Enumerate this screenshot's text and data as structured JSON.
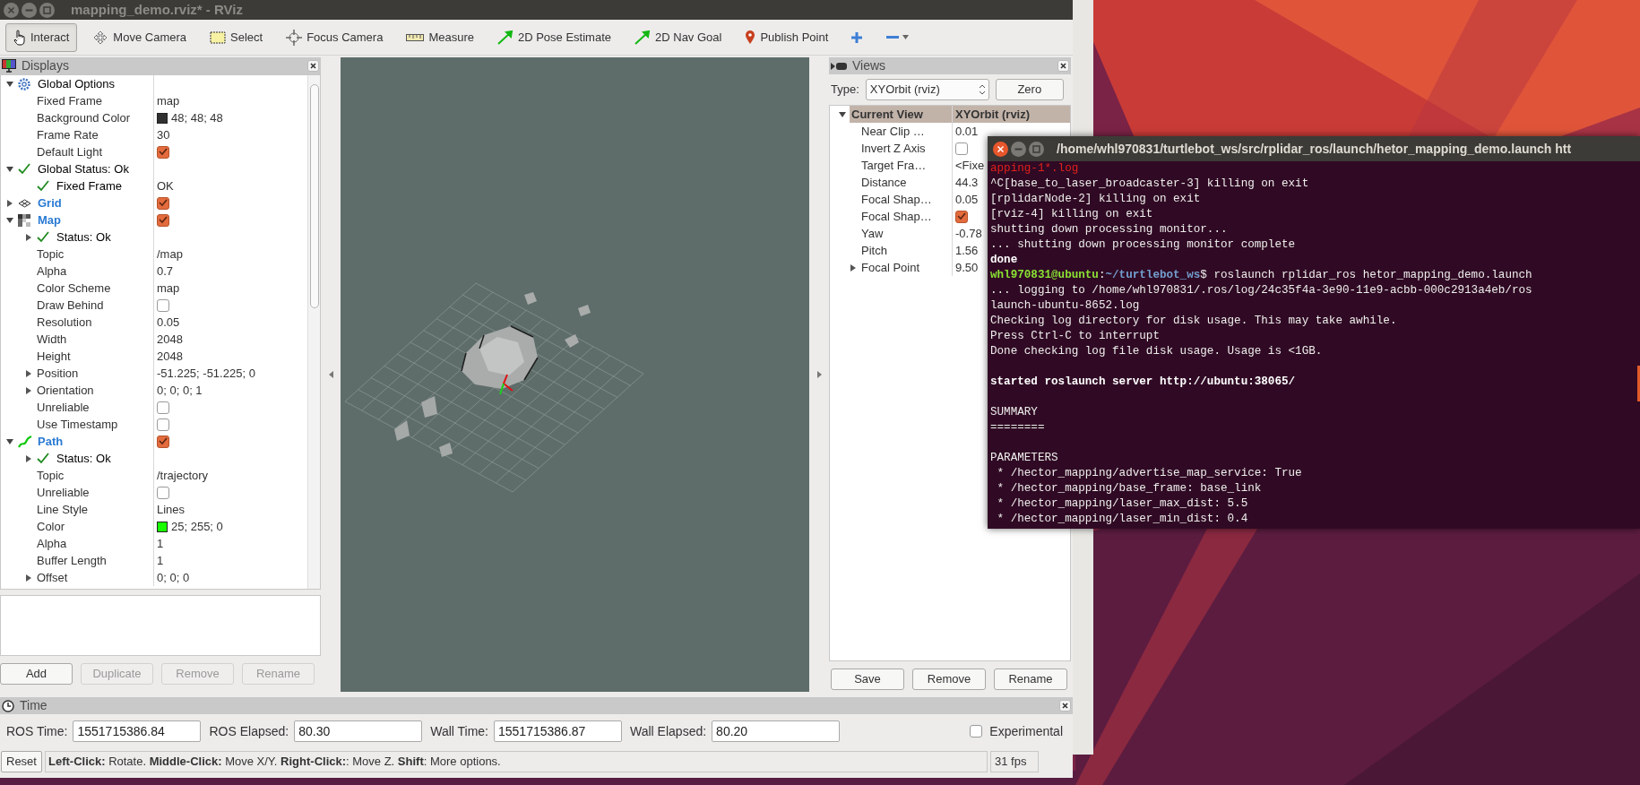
{
  "window": {
    "title": "mapping_demo.rviz* - RViz"
  },
  "toolbar": {
    "tools": [
      {
        "label": "Interact",
        "selected": true
      },
      {
        "label": "Move Camera",
        "selected": false
      },
      {
        "label": "Select",
        "selected": false
      },
      {
        "label": "Focus Camera",
        "selected": false
      },
      {
        "label": "Measure",
        "selected": false
      },
      {
        "label": "2D Pose Estimate",
        "selected": false
      },
      {
        "label": "2D Nav Goal",
        "selected": false
      },
      {
        "label": "Publish Point",
        "selected": false
      }
    ]
  },
  "displays": {
    "title": "Displays",
    "tree": [
      {
        "label": "Global Options",
        "kind": "options",
        "expanded": true,
        "children": [
          {
            "label": "Fixed Frame",
            "kind": "property",
            "value": "map"
          },
          {
            "label": "Background Color",
            "kind": "property",
            "value": "48; 48; 48",
            "color": "#303030"
          },
          {
            "label": "Frame Rate",
            "kind": "property",
            "value": "30"
          },
          {
            "label": "Default Light",
            "kind": "property",
            "checked": true
          }
        ]
      },
      {
        "label": "Global Status: Ok",
        "kind": "status",
        "expanded": true,
        "children": [
          {
            "label": "Fixed Frame",
            "kind": "status",
            "value": "OK"
          }
        ]
      },
      {
        "label": "Grid",
        "kind": "grid",
        "expanded": false,
        "checked": true
      },
      {
        "label": "Map",
        "kind": "map",
        "expanded": true,
        "checked": true,
        "children": [
          {
            "label": "Status: Ok",
            "kind": "status",
            "expanded": false
          },
          {
            "label": "Topic",
            "kind": "property",
            "value": "/map"
          },
          {
            "label": "Alpha",
            "kind": "property",
            "value": "0.7"
          },
          {
            "label": "Color Scheme",
            "kind": "property",
            "value": "map"
          },
          {
            "label": "Draw Behind",
            "kind": "property",
            "checked": false
          },
          {
            "label": "Resolution",
            "kind": "property",
            "value": "0.05"
          },
          {
            "label": "Width",
            "kind": "property",
            "value": "2048"
          },
          {
            "label": "Height",
            "kind": "property",
            "value": "2048"
          },
          {
            "label": "Position",
            "kind": "property",
            "expanded": false,
            "value": "-51.225; -51.225; 0"
          },
          {
            "label": "Orientation",
            "kind": "property",
            "expanded": false,
            "value": "0; 0; 0; 1"
          },
          {
            "label": "Unreliable",
            "kind": "property",
            "checked": false
          },
          {
            "label": "Use Timestamp",
            "kind": "property",
            "checked": false
          }
        ]
      },
      {
        "label": "Path",
        "kind": "path",
        "expanded": true,
        "checked": true,
        "children": [
          {
            "label": "Status: Ok",
            "kind": "status",
            "expanded": false
          },
          {
            "label": "Topic",
            "kind": "property",
            "value": "/trajectory"
          },
          {
            "label": "Unreliable",
            "kind": "property",
            "checked": false
          },
          {
            "label": "Line Style",
            "kind": "property",
            "value": "Lines"
          },
          {
            "label": "Color",
            "kind": "property",
            "value": "25; 255; 0",
            "color": "#19ff00"
          },
          {
            "label": "Alpha",
            "kind": "property",
            "value": "1"
          },
          {
            "label": "Buffer Length",
            "kind": "property",
            "value": "1"
          },
          {
            "label": "Offset",
            "kind": "property",
            "expanded": false,
            "value": "0; 0; 0"
          }
        ]
      }
    ],
    "buttons": [
      {
        "label": "Add",
        "disabled": false
      },
      {
        "label": "Duplicate",
        "disabled": true
      },
      {
        "label": "Remove",
        "disabled": true
      },
      {
        "label": "Rename",
        "disabled": true
      }
    ]
  },
  "views": {
    "title": "Views",
    "type_label": "Type:",
    "type_value": "XYOrbit (rviz)",
    "zero": "Zero",
    "tree": {
      "label": "Current View",
      "value": "XYOrbit (rviz)",
      "expanded": true,
      "children": [
        {
          "label": "Near Clip …",
          "value": "0.01"
        },
        {
          "label": "Invert Z Axis",
          "checked": false
        },
        {
          "label": "Target Fra…",
          "value": "<Fixe"
        },
        {
          "label": "Distance",
          "value": "44.3"
        },
        {
          "label": "Focal Shap…",
          "value": "0.05"
        },
        {
          "label": "Focal Shap…",
          "checked": true
        },
        {
          "label": "Yaw",
          "value": "-0.78"
        },
        {
          "label": "Pitch",
          "value": "1.56"
        },
        {
          "label": "Focal Point",
          "expanded": false,
          "value": "9.50"
        }
      ]
    },
    "buttons": [
      "Save",
      "Remove",
      "Rename"
    ]
  },
  "time": {
    "title": "Time",
    "fields": [
      {
        "label": "ROS Time:",
        "value": "1551715386.84"
      },
      {
        "label": "ROS Elapsed:",
        "value": "80.30"
      },
      {
        "label": "Wall Time:",
        "value": "1551715386.87"
      },
      {
        "label": "Wall Elapsed:",
        "value": "80.20"
      }
    ],
    "experimental": {
      "label": "Experimental",
      "checked": false
    }
  },
  "status_bar": {
    "reset": "Reset",
    "hint": "**Left-Click:** Rotate. **Middle-Click:** Move X/Y. **Right-Click:**: Move Z. **Shift**: More options.",
    "fps": "31 fps"
  },
  "terminal": {
    "title": "/home/whl970831/turtlebot_ws/src/rplidar_ros/launch/hetor_mapping_demo.launch htt",
    "blocks": [
      [
        {
          "kind": "error",
          "text": "apping-1*.log"
        },
        {
          "kind": "plain",
          "text": "^C[base_to_laser_broadcaster-3] killing on exit"
        },
        {
          "kind": "plain",
          "text": "[rplidarNode-2] killing on exit"
        },
        {
          "kind": "plain",
          "text": "[rviz-4] killing on exit"
        },
        {
          "kind": "plain",
          "text": "shutting down processing monitor..."
        },
        {
          "kind": "plain",
          "text": "... shutting down processing monitor complete"
        },
        {
          "kind": "bold",
          "text": "done"
        },
        {
          "kind": "prompt",
          "user": "whl970831@ubuntu",
          "sep": ":",
          "path": "~/turtlebot_ws",
          "text": "$ roslaunch rplidar_ros hetor_mapping_demo.launch"
        },
        {
          "kind": "plain",
          "text": "... logging to /home/whl970831/.ros/log/24c35f4a-3e90-11e9-acbb-000c2913a4eb/ros"
        },
        {
          "kind": "plain",
          "text": "launch-ubuntu-8652.log"
        },
        {
          "kind": "plain",
          "text": "Checking log directory for disk usage. This may take awhile."
        },
        {
          "kind": "plain",
          "text": "Press Ctrl-C to interrupt"
        },
        {
          "kind": "plain",
          "text": "Done checking log file disk usage. Usage is <1GB."
        }
      ],
      [
        {
          "kind": "bold",
          "text": "started roslaunch server http://ubuntu:38065/"
        }
      ],
      [
        {
          "kind": "plain",
          "text": "SUMMARY"
        },
        {
          "kind": "plain",
          "text": "========"
        }
      ],
      [
        {
          "kind": "plain",
          "text": "PARAMETERS"
        },
        {
          "kind": "plain",
          "text": " * /hector_mapping/advertise_map_service: True"
        },
        {
          "kind": "plain",
          "text": " * /hector_mapping/base_frame: base_link"
        },
        {
          "kind": "plain",
          "text": " * /hector_mapping/laser_max_dist: 5.5"
        },
        {
          "kind": "plain",
          "text": " * /hector_mapping/laser_min_dist: 0.4"
        }
      ]
    ]
  }
}
